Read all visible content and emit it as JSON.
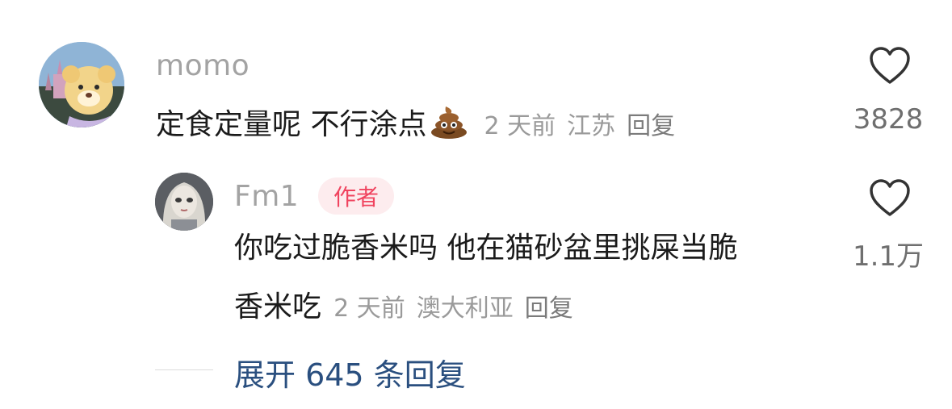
{
  "comment": {
    "username": "momo",
    "text": "定食定量呢 不行涂点",
    "emoji_icon": "poop-emoji-icon",
    "time": "2 天前",
    "location": "江苏",
    "reply_label": "回复",
    "like_count": "3828"
  },
  "reply": {
    "username": "Fm1",
    "badge": "作者",
    "text_line1": "你吃过脆香米吗 他在猫砂盆里挑屎当脆",
    "text_line2": "香米吃",
    "time": "2 天前",
    "location": "澳大利亚",
    "reply_label": "回复",
    "like_count": "1.1万"
  },
  "expand_label": "展开 645 条回复",
  "colors": {
    "accent_link": "#2a4f7f",
    "badge_text": "#f0445f",
    "badge_bg": "#fdecee"
  }
}
